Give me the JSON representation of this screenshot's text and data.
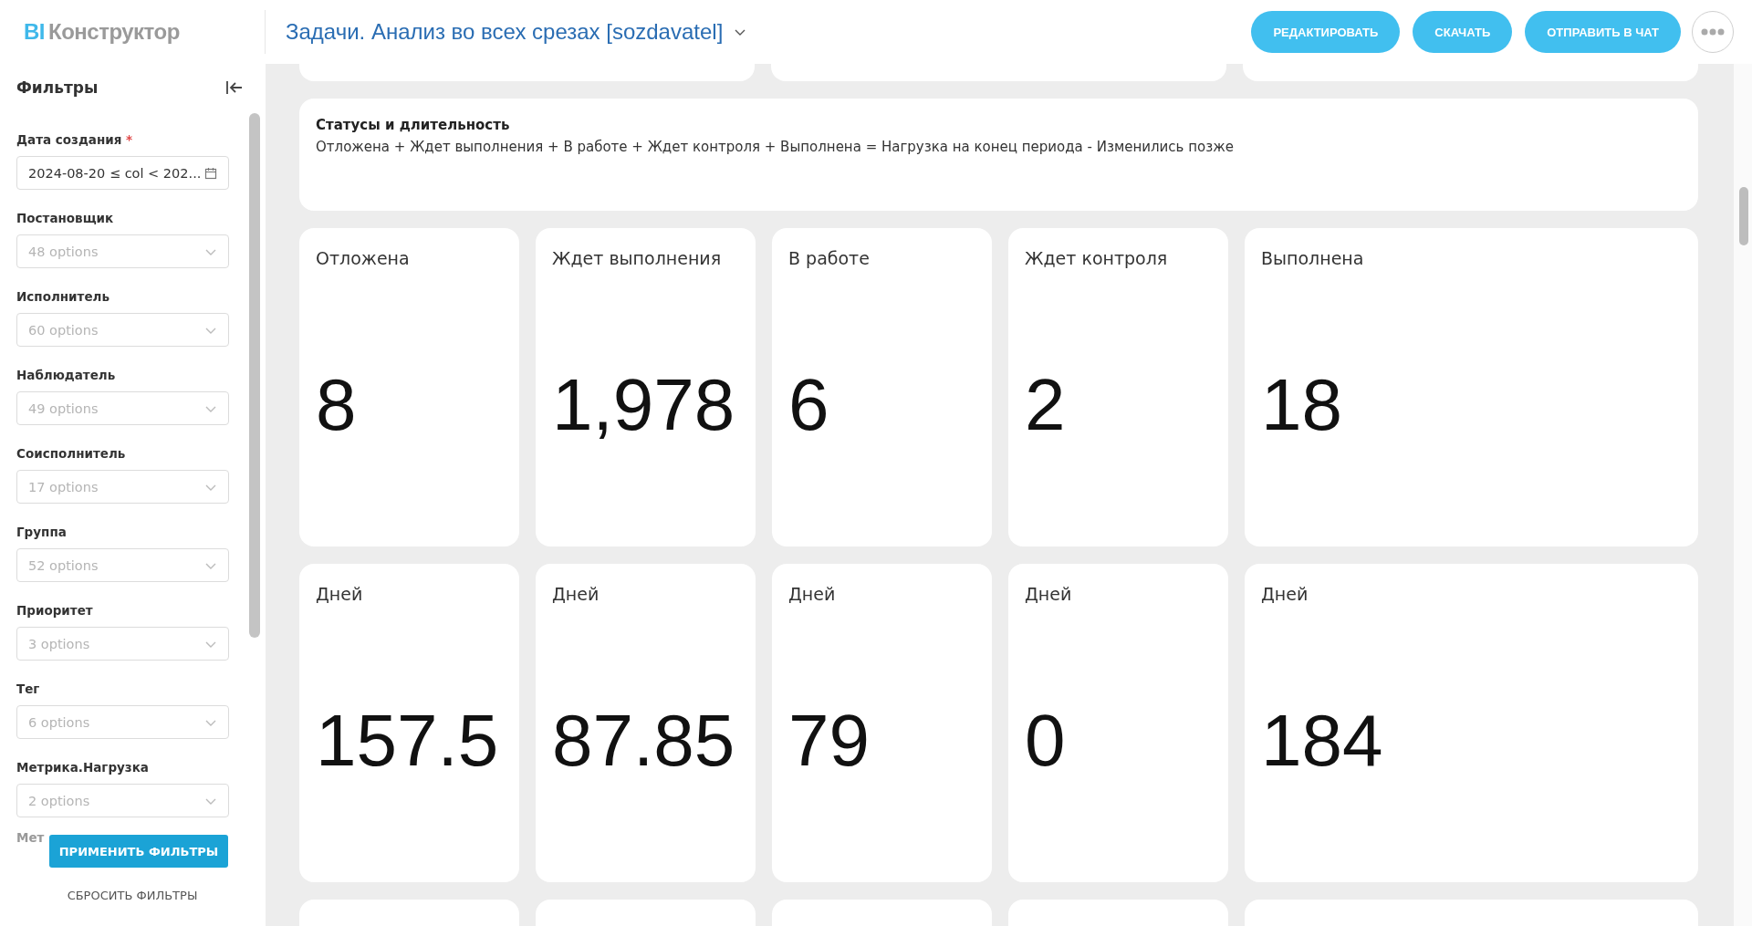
{
  "header": {
    "logo": {
      "prefix": "BI",
      "text": "Конструктор"
    },
    "title": "Задачи. Анализ во всех срезах [sozdavatel]",
    "actions": [
      "РЕДАКТИРОВАТЬ",
      "СКАЧАТЬ",
      "ОТПРАВИТЬ В ЧАТ"
    ]
  },
  "sidebar": {
    "title": "Фильтры",
    "filters": [
      {
        "label": "Дата создания",
        "required": true,
        "kind": "date",
        "value": "2024-08-20 ≤ col < 202..."
      },
      {
        "label": "Постановщик",
        "required": false,
        "kind": "select",
        "placeholder": "48 options"
      },
      {
        "label": "Исполнитель",
        "required": false,
        "kind": "select",
        "placeholder": "60 options"
      },
      {
        "label": "Наблюдатель",
        "required": false,
        "kind": "select",
        "placeholder": "49 options"
      },
      {
        "label": "Соисполнитель",
        "required": false,
        "kind": "select",
        "placeholder": "17 options"
      },
      {
        "label": "Группа",
        "required": false,
        "kind": "select",
        "placeholder": "52 options"
      },
      {
        "label": "Приоритет",
        "required": false,
        "kind": "select",
        "placeholder": "3 options"
      },
      {
        "label": "Тег",
        "required": false,
        "kind": "select",
        "placeholder": "6 options"
      },
      {
        "label": "Метрика.Нагрузка",
        "required": false,
        "kind": "select",
        "placeholder": "2 options"
      }
    ],
    "required_mark": "*",
    "partial_label": "Мет",
    "apply": "ПРИМЕНИТЬ ФИЛЬТРЫ",
    "reset": "СБРОСИТЬ ФИЛЬТРЫ"
  },
  "description": {
    "title": "Статусы и длительность",
    "text": "Отложена + Ждет выполнения + В работе + Ждет контроля + Выполнена = Нагрузка на конец периода - Изменились позже"
  },
  "metric_rows": [
    {
      "cards": [
        {
          "label": "Отложена",
          "value": "8"
        },
        {
          "label": "Ждет выполнения",
          "value": "1,978"
        },
        {
          "label": "В работе",
          "value": "6"
        },
        {
          "label": "Ждет контроля",
          "value": "2"
        },
        {
          "label": "Выполнена",
          "value": "18"
        }
      ]
    },
    {
      "cards": [
        {
          "label": "Дней",
          "value": "157.5"
        },
        {
          "label": "Дней",
          "value": "87.85"
        },
        {
          "label": "Дней",
          "value": "79"
        },
        {
          "label": "Дней",
          "value": "0"
        },
        {
          "label": "Дней",
          "value": "184"
        }
      ]
    }
  ]
}
